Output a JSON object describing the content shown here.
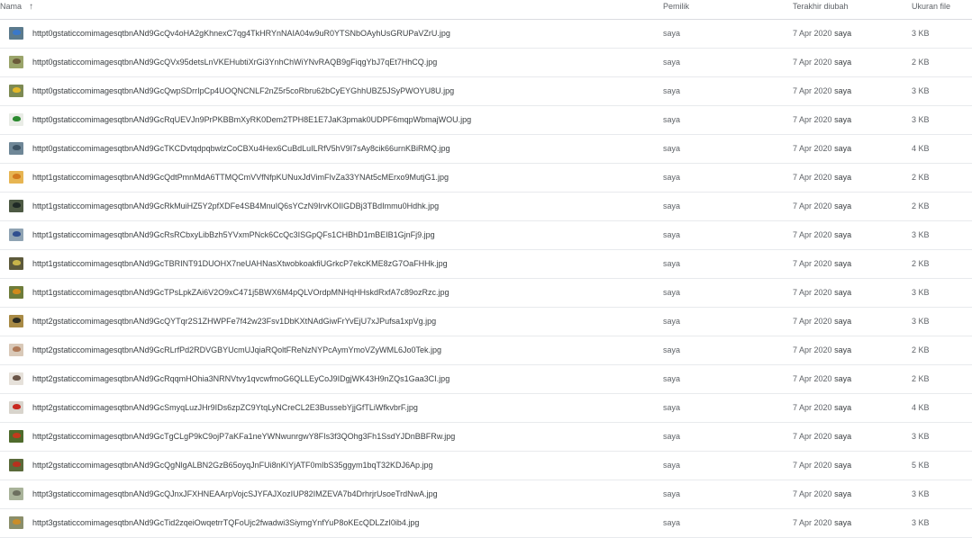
{
  "header": {
    "name_label": "Nama",
    "sort_arrow": "↑",
    "owner_label": "Pemilik",
    "modified_label": "Terakhir diubah",
    "size_label": "Ukuran file"
  },
  "files": [
    {
      "name": "httpt0gstaticcomimagesqtbnANd9GcQv4oHA2gKhnexC7qg4TkHRYnNAIA04w9uR0YTSNbOAyhUsGRUPaVZrU.jpg",
      "owner": "saya",
      "date": "7 Apr 2020",
      "by": "saya",
      "size": "3 KB",
      "thumb_bg": "#5b7a8c",
      "thumb_bird": "#3a78c9"
    },
    {
      "name": "httpt0gstaticcomimagesqtbnANd9GcQVx95detsLnVKEHubtiXrGi3YnhChWiYNvRAQB9gFiqgYbJ7qEt7HhCQ.jpg",
      "owner": "saya",
      "date": "7 Apr 2020",
      "by": "saya",
      "size": "2 KB",
      "thumb_bg": "#9aa46a",
      "thumb_bird": "#6b5a3a"
    },
    {
      "name": "httpt0gstaticcomimagesqtbnANd9GcQwpSDrrIpCp4UOQNCNLF2nZ5r5coRbru62bCyEYGhhUBZ5JSyPWOYU8U.jpg",
      "owner": "saya",
      "date": "7 Apr 2020",
      "by": "saya",
      "size": "3 KB",
      "thumb_bg": "#7d8a52",
      "thumb_bird": "#e3b82a"
    },
    {
      "name": "httpt0gstaticcomimagesqtbnANd9GcRqUEVJn9PrPKBBmXyRK0Dem2TPH8E1E7JaK3pmak0UDPF6mqpWbmajWOU.jpg",
      "owner": "saya",
      "date": "7 Apr 2020",
      "by": "saya",
      "size": "3 KB",
      "thumb_bg": "#e9ece6",
      "thumb_bird": "#2b8a2f"
    },
    {
      "name": "httpt0gstaticcomimagesqtbnANd9GcTKCDvtqdpqbwlzCoCBXu4Hex6CuBdLuILRfV5hV9I7sAy8cik66urnKBiRMQ.jpg",
      "owner": "saya",
      "date": "7 Apr 2020",
      "by": "saya",
      "size": "4 KB",
      "thumb_bg": "#6f8797",
      "thumb_bird": "#3d5364"
    },
    {
      "name": "httpt1gstaticcomimagesqtbnANd9GcQdtPmnMdA6TTMQCmVVfNfpKUNuxJdVimFIvZa33YNAt5cMErxo9MutjG1.jpg",
      "owner": "saya",
      "date": "7 Apr 2020",
      "by": "saya",
      "size": "2 KB",
      "thumb_bg": "#e7b552",
      "thumb_bird": "#d27a1f"
    },
    {
      "name": "httpt1gstaticcomimagesqtbnANd9GcRkMuiHZ5Y2pfXDFe4SB4MnuIQ6sYCzN9IrvKOIIGDBj3TBdImmu0Hdhk.jpg",
      "owner": "saya",
      "date": "7 Apr 2020",
      "by": "saya",
      "size": "2 KB",
      "thumb_bg": "#4d5a44",
      "thumb_bird": "#1f2a26"
    },
    {
      "name": "httpt1gstaticcomimagesqtbnANd9GcRsRCbxyLibBzh5YVxmPNck6CcQc3ISGpQFs1CHBhD1mBEIB1GjnFj9.jpg",
      "owner": "saya",
      "date": "7 Apr 2020",
      "by": "saya",
      "size": "3 KB",
      "thumb_bg": "#8fa3b3",
      "thumb_bird": "#2f4f8f"
    },
    {
      "name": "httpt1gstaticcomimagesqtbnANd9GcTBRINT91DUOHX7neUAHNasXtwobkoakfiUGrkcP7ekcKME8zG7OaFHHk.jpg",
      "owner": "saya",
      "date": "7 Apr 2020",
      "by": "saya",
      "size": "2 KB",
      "thumb_bg": "#5d5a3b",
      "thumb_bird": "#c9b54a"
    },
    {
      "name": "httpt1gstaticcomimagesqtbnANd9GcTPsLpkZAi6V2O9xC471j5BWX6M4pQLVOrdpMNHqHHskdRxfA7c89ozRzc.jpg",
      "owner": "saya",
      "date": "7 Apr 2020",
      "by": "saya",
      "size": "3 KB",
      "thumb_bg": "#6e7c3a",
      "thumb_bird": "#d08a1c"
    },
    {
      "name": "httpt2gstaticcomimagesqtbnANd9GcQYTqr2S1ZHWPFe7f42w23Fsv1DbKXtNAdGiwFrYvEjU7xJPufsa1xpVg.jpg",
      "owner": "saya",
      "date": "7 Apr 2020",
      "by": "saya",
      "size": "3 KB",
      "thumb_bg": "#a88a45",
      "thumb_bird": "#2b2b22"
    },
    {
      "name": "httpt2gstaticcomimagesqtbnANd9GcRLrfPd2RDVGBYUcmUJqiaRQoltFReNzNYPcAymYmoVZyWML6Jo0Tek.jpg",
      "owner": "saya",
      "date": "7 Apr 2020",
      "by": "saya",
      "size": "2 KB",
      "thumb_bg": "#d9c9b8",
      "thumb_bird": "#b07a58"
    },
    {
      "name": "httpt2gstaticcomimagesqtbnANd9GcRqqmHOhia3NRNVtvy1qvcwfmoG6QLLEyCoJ9IDgjWK43H9nZQs1Gaa3CI.jpg",
      "owner": "saya",
      "date": "7 Apr 2020",
      "by": "saya",
      "size": "2 KB",
      "thumb_bg": "#e6e1da",
      "thumb_bird": "#6a5548"
    },
    {
      "name": "httpt2gstaticcomimagesqtbnANd9GcSmyqLuzJHr9IDs6zpZC9YtqLyNCreCL2E3BussebYjjGfTLiWfkvbrF.jpg",
      "owner": "saya",
      "date": "7 Apr 2020",
      "by": "saya",
      "size": "4 KB",
      "thumb_bg": "#d8d4cc",
      "thumb_bird": "#c8281f"
    },
    {
      "name": "httpt2gstaticcomimagesqtbnANd9GcTgCLgP9kC9ojP7aKFa1neYWNwunrgwY8FIs3f3QOhg3Fh1SsdYJDnBBFRw.jpg",
      "owner": "saya",
      "date": "7 Apr 2020",
      "by": "saya",
      "size": "3 KB",
      "thumb_bg": "#4f6b2c",
      "thumb_bird": "#c13a1c"
    },
    {
      "name": "httpt2gstaticcomimagesqtbnANd9GcQgNlgALBN2GzB65oyqJnFUi8nKIYjATF0mIbS35ggym1bqT32KDJ6Ap.jpg",
      "owner": "saya",
      "date": "7 Apr 2020",
      "by": "saya",
      "size": "5 KB",
      "thumb_bg": "#5a6a3a",
      "thumb_bird": "#b8301e"
    },
    {
      "name": "httpt3gstaticcomimagesqtbnANd9GcQJnxJFXHNEAArpVojcSJYFAJXozIUP82IMZEVA7b4DrhrjrUsoeTrdNwA.jpg",
      "owner": "saya",
      "date": "7 Apr 2020",
      "by": "saya",
      "size": "3 KB",
      "thumb_bg": "#a9b39a",
      "thumb_bird": "#6d7060"
    },
    {
      "name": "httpt3gstaticcomimagesqtbnANd9GcTid2zqeiOwqetrrTQFoUjc2fwadwi3SiymgYnfYuP8oKEcQDLZzI0ib4.jpg",
      "owner": "saya",
      "date": "7 Apr 2020",
      "by": "saya",
      "size": "3 KB",
      "thumb_bg": "#8a8e6a",
      "thumb_bird": "#c98d2a"
    }
  ]
}
